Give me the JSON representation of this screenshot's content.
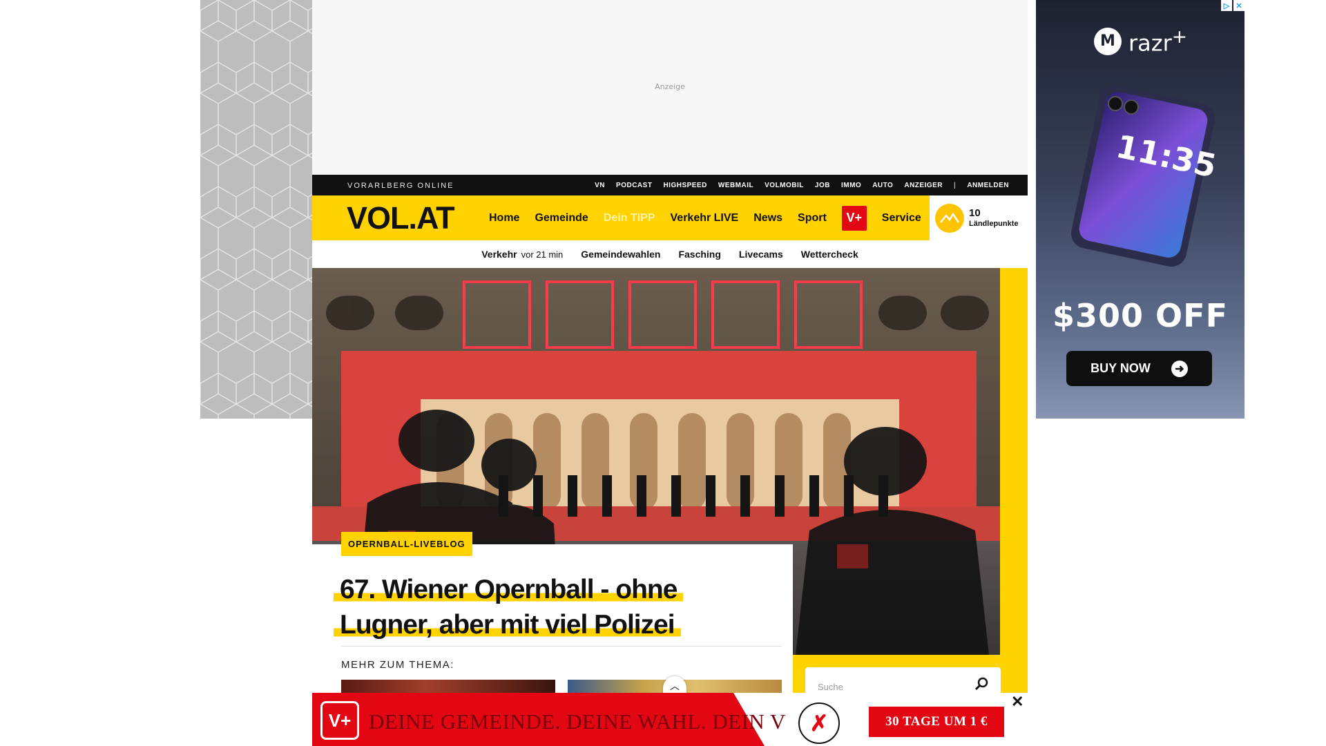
{
  "ads": {
    "top_label": "Anzeige",
    "right": {
      "brand": "razr",
      "brand_sup": "+",
      "logo_letter": "M",
      "phone_time": "11:35",
      "offer": "$300 OFF",
      "cta": "BUY NOW",
      "adchoices_icon": "adchoices-icon",
      "close_icon": "close-icon"
    }
  },
  "topbar": {
    "site_name": "VORARLBERG ONLINE",
    "links": [
      "VN",
      "PODCAST",
      "HIGHSPEED",
      "WEBMAIL",
      "VOLMOBIL",
      "JOB",
      "IMMO",
      "AUTO",
      "ANZEIGER"
    ],
    "separator": "|",
    "login": "ANMELDEN"
  },
  "nav": {
    "logo": "VOL.AT",
    "items": [
      "Home",
      "Gemeinde",
      "Dein TIPP",
      "Verkehr LIVE",
      "News",
      "Sport"
    ],
    "vplus": "V+",
    "service": "Service",
    "points_value": "10",
    "points_label": "Ländlepunkte"
  },
  "subnav": {
    "traffic_label": "Verkehr",
    "traffic_time": "vor 21 min",
    "items": [
      "Gemeindewahlen",
      "Fasching",
      "Livecams",
      "Wettercheck"
    ]
  },
  "article": {
    "tag": "OPERNBALL-LIVEBLOG",
    "headline_line1": "67. Wiener Opernball - ohne",
    "headline_line2": "Lugner, aber mit viel Polizei",
    "more_label": "MEHR ZUM THEMA:"
  },
  "search": {
    "placeholder": "Suche"
  },
  "sticky_banner": {
    "logo": "V+",
    "slogan": "DEINE GEMEINDE. DEINE WAHL. DEIN V",
    "cta": "30 TAGE UM 1 €",
    "close": "✕"
  },
  "colors": {
    "brand_yellow": "#ffd200",
    "brand_red": "#e30613",
    "topbar": "#111111"
  }
}
